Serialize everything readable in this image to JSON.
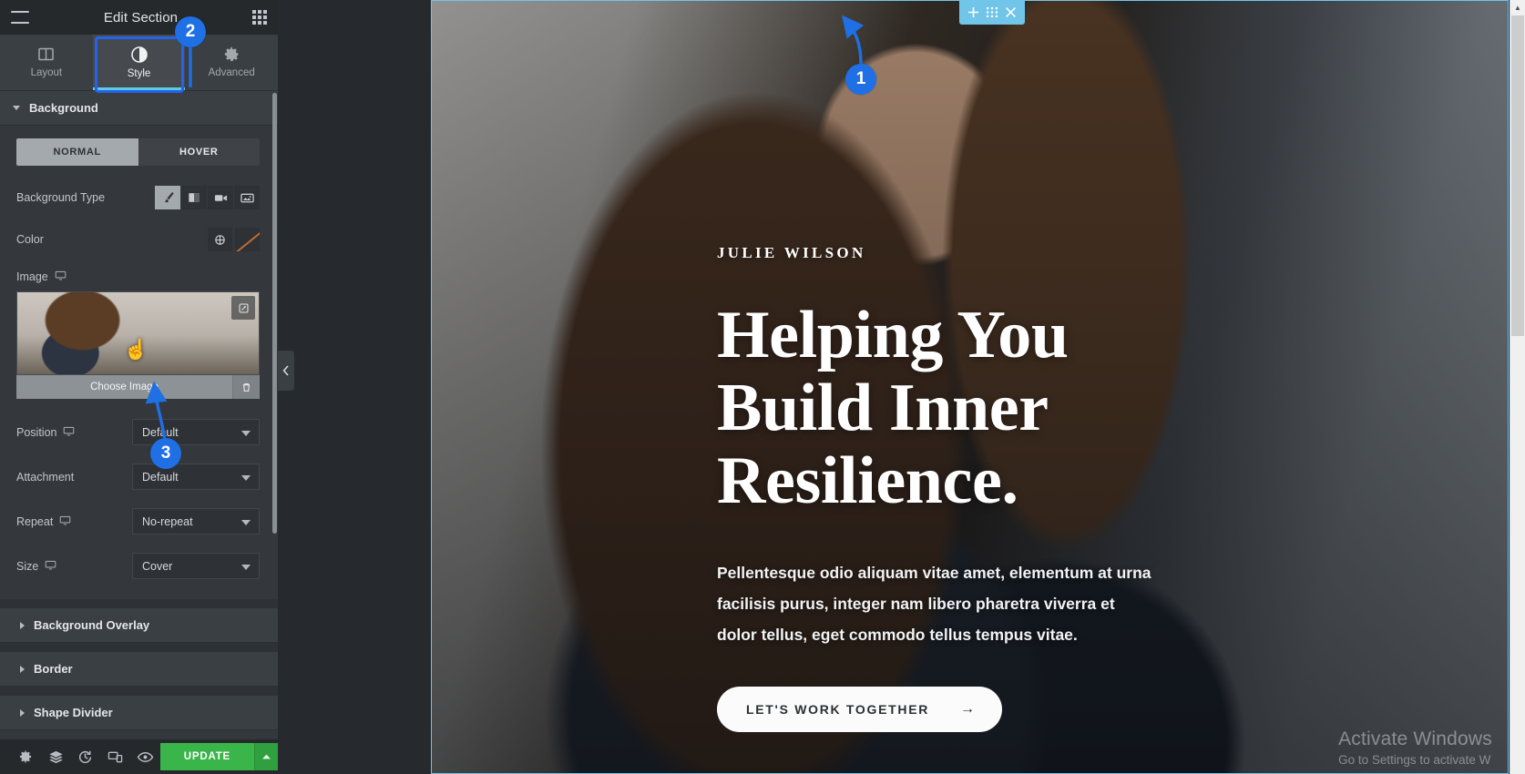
{
  "panel": {
    "header": {
      "title": "Edit Section",
      "menu_icon": "hamburger-icon",
      "apps_icon": "apps-grid-icon"
    },
    "tabs": [
      {
        "label": "Layout",
        "icon": "layout-columns-icon",
        "active": false
      },
      {
        "label": "Style",
        "icon": "contrast-circle-icon",
        "active": true
      },
      {
        "label": "Advanced",
        "icon": "gear-icon",
        "active": false
      }
    ],
    "sections": [
      {
        "label": "Background",
        "state": "open"
      },
      {
        "label": "Background Overlay",
        "state": "collapsed"
      },
      {
        "label": "Border",
        "state": "collapsed"
      },
      {
        "label": "Shape Divider",
        "state": "collapsed"
      }
    ],
    "background": {
      "state_toggle": {
        "options": [
          "NORMAL",
          "HOVER"
        ],
        "selected": "NORMAL"
      },
      "background_type": {
        "label": "Background Type",
        "options": [
          {
            "icon": "paint-brush-icon",
            "name": "classic",
            "selected": true
          },
          {
            "icon": "gradient-icon",
            "name": "gradient",
            "selected": false
          },
          {
            "icon": "video-camera-icon",
            "name": "video",
            "selected": false
          },
          {
            "icon": "slideshow-icon",
            "name": "slideshow",
            "selected": false
          }
        ]
      },
      "color": {
        "label": "Color",
        "picker_icon": "globe-color-icon",
        "swatch_color": "#c06a2e"
      },
      "image": {
        "label": "Image",
        "device_icon": "monitor-icon",
        "choose_label": "Choose Image",
        "delete_icon": "trash-icon",
        "edit_icon": "pencil-square-icon"
      },
      "fields": [
        {
          "label": "Position",
          "device_icon": "monitor-icon",
          "value": "Default"
        },
        {
          "label": "Attachment",
          "device_icon": "monitor-icon",
          "value": "Default"
        },
        {
          "label": "Repeat",
          "device_icon": "monitor-icon",
          "value": "No-repeat"
        },
        {
          "label": "Size",
          "device_icon": "monitor-icon",
          "value": "Cover"
        }
      ]
    },
    "footer": {
      "buttons": [
        {
          "icon": "gear-icon",
          "name": "settings"
        },
        {
          "icon": "layers-icon",
          "name": "navigator"
        },
        {
          "icon": "history-icon",
          "name": "history"
        },
        {
          "icon": "responsive-icon",
          "name": "responsive-mode"
        },
        {
          "icon": "eye-icon",
          "name": "preview"
        }
      ],
      "update_label": "UPDATE",
      "update_more_icon": "caret-up-icon",
      "update_color": "#39b54a"
    },
    "collapse_handle_icon": "chevron-left-icon"
  },
  "canvas": {
    "section_handle": {
      "add_icon": "plus-icon",
      "edit_icon": "grid-dots-icon",
      "close_icon": "close-icon",
      "color": "#71c5e8"
    },
    "hero": {
      "eyebrow": "JULIE WILSON",
      "headline": "Helping You Build Inner Resilience.",
      "subcopy": "Pellentesque odio aliquam vitae amet, elementum at urna facilisis purus, integer nam libero pharetra viverra et dolor tellus, eget commodo tellus tempus vitae.",
      "cta_label": "LET'S WORK TOGETHER",
      "cta_arrow": "→"
    }
  },
  "watermark": {
    "line1": "Activate Windows",
    "line2": "Go to Settings to activate W"
  },
  "callouts": [
    {
      "number": "1",
      "target": "section-handle-edit-icon"
    },
    {
      "number": "2",
      "target": "tab-style"
    },
    {
      "number": "3",
      "target": "choose-image-button"
    }
  ],
  "colors": {
    "callout_blue": "#1f6fe5",
    "highlight_blue": "#2563eb",
    "tab_accent": "#5ecbe4",
    "panel_bg": "#34383c",
    "panel_header_bg": "#26292c"
  }
}
